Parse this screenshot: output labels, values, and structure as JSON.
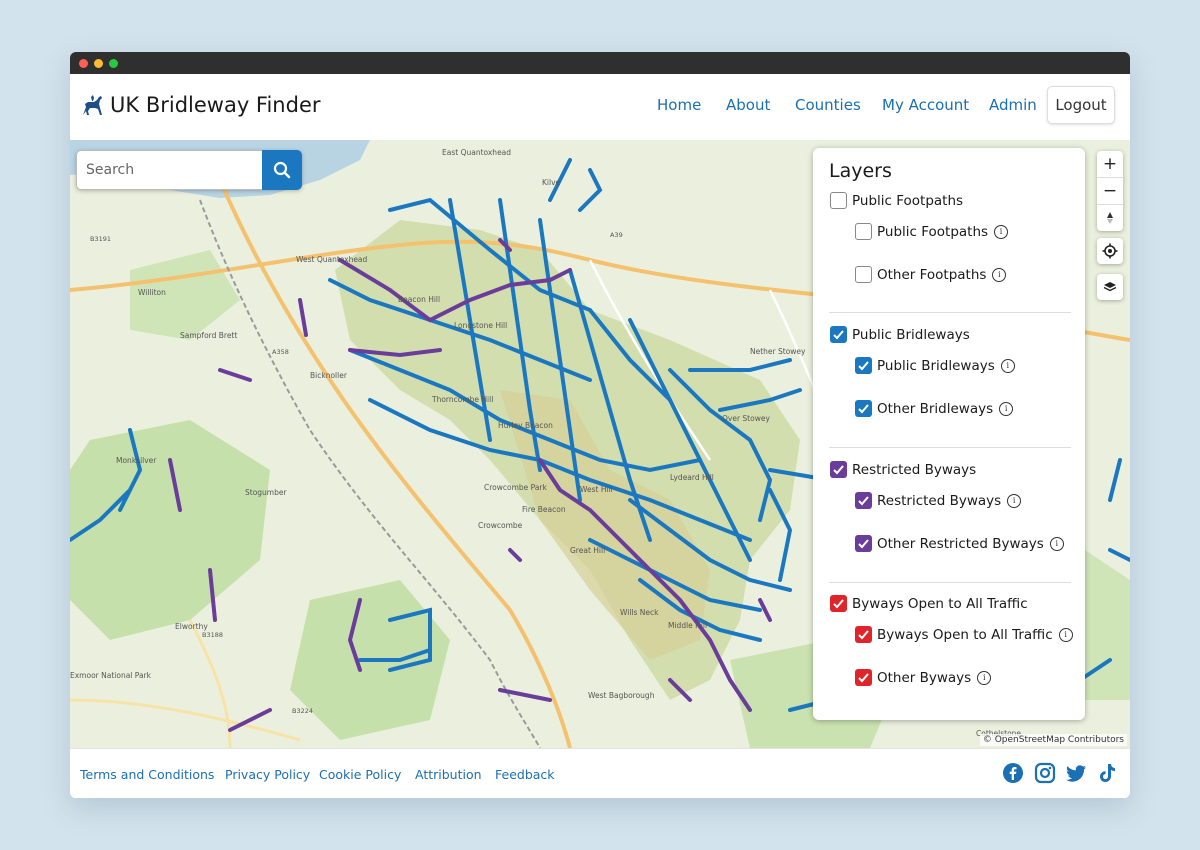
{
  "brand": {
    "title": "UK Bridleway Finder"
  },
  "nav": {
    "links": [
      "Home",
      "About",
      "Counties",
      "My Account",
      "Admin"
    ],
    "logout_label": "Logout"
  },
  "search": {
    "placeholder": "Search"
  },
  "layers": {
    "title": "Layers",
    "groups": [
      {
        "label": "Public Footpaths",
        "checked": false,
        "color": "#ffffff",
        "items": [
          {
            "label": "Public Footpaths",
            "checked": false
          },
          {
            "label": "Other Footpaths",
            "checked": false
          }
        ]
      },
      {
        "label": "Public Bridleways",
        "checked": true,
        "color": "#1b78c0",
        "items": [
          {
            "label": "Public Bridleways",
            "checked": true
          },
          {
            "label": "Other Bridleways",
            "checked": true
          }
        ]
      },
      {
        "label": "Restricted Byways",
        "checked": true,
        "color": "#6a3d9a",
        "items": [
          {
            "label": "Restricted Byways",
            "checked": true
          },
          {
            "label": "Other Restricted Byways",
            "checked": true
          }
        ]
      },
      {
        "label": "Byways Open to All Traffic",
        "checked": true,
        "color": "#e0242b",
        "items": [
          {
            "label": "Byways Open to All Traffic",
            "checked": true
          },
          {
            "label": "Other Byways",
            "checked": true
          }
        ]
      }
    ]
  },
  "map": {
    "attribution": "© OpenStreetMap Contributors",
    "places": [
      "East Quantoxhead",
      "Kilve",
      "West Quantoxhead",
      "Williton",
      "Sampford Brett",
      "Bicknoller",
      "Nether Stowey",
      "Over Stowey",
      "Monksilver",
      "Stogumber",
      "Crowcombe",
      "Elworthy",
      "West Bagborough",
      "Cothelstone",
      "Wills Neck",
      "Middle Hill",
      "Great Hill",
      "West Hill",
      "Longstone Hill",
      "Hurley Beacon",
      "Beacon Hill",
      "Thorncombe Hill",
      "Exmoor National Park",
      "Fire Beacon",
      "Lydeard Hill",
      "Crowcombe Park"
    ],
    "roads": [
      "A39",
      "B3191",
      "A358",
      "B3188",
      "B3224"
    ],
    "route_colors": {
      "bridleway": "#1b78c0",
      "restricted": "#6a3d9a",
      "byway": "#e0242b"
    }
  },
  "footer": {
    "links": [
      "Terms and Conditions",
      "Privacy Policy",
      "Cookie Policy",
      "Attribution",
      "Feedback"
    ],
    "social": [
      "facebook-icon",
      "instagram-icon",
      "twitter-icon",
      "tiktok-icon"
    ]
  }
}
